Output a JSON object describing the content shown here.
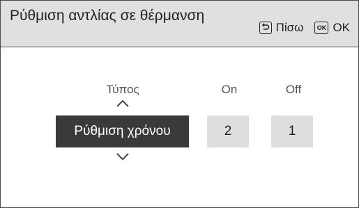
{
  "header": {
    "title": "Ρύθμιση αντλίας σε θέρμανση",
    "back_label": "Πίσω",
    "ok_icon_text": "OK",
    "ok_label": "OK"
  },
  "settings": {
    "type_label": "Τύπος",
    "on_label": "On",
    "off_label": "Off",
    "type_value": "Ρύθμιση χρόνου",
    "on_value": "2",
    "off_value": "1"
  },
  "icons": {
    "back": "back-arrow-icon",
    "ok": "ok-icon",
    "up": "chevron-up-icon",
    "down": "chevron-down-icon"
  },
  "colors": {
    "header_bg": "#e0e0e0",
    "selected_bg": "#3a3a3a",
    "value_bg": "#dedede"
  }
}
